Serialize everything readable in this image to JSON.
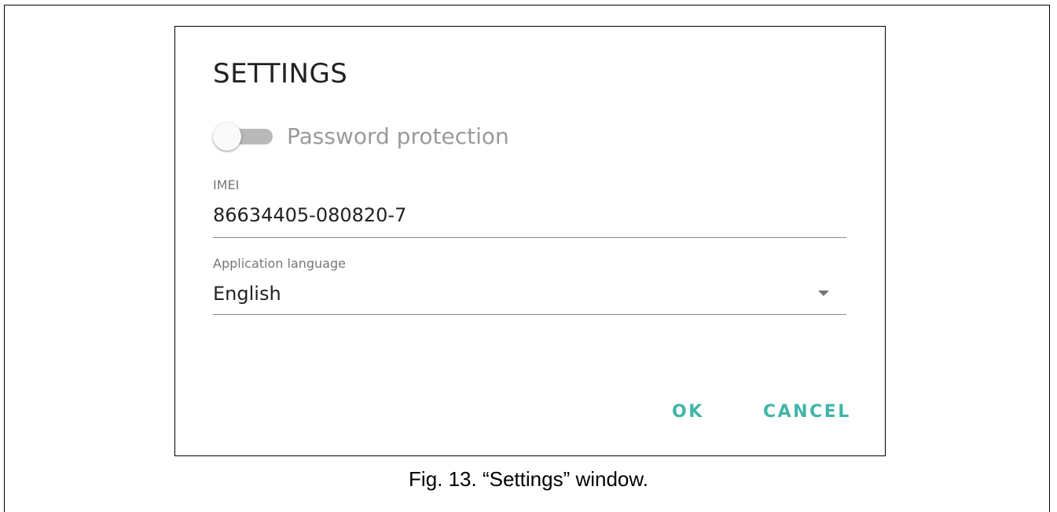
{
  "dialog": {
    "title": "SETTINGS",
    "password_protection": {
      "label": "Password protection",
      "enabled": false
    },
    "imei": {
      "label": "IMEI",
      "value": "86634405-080820-7"
    },
    "language": {
      "label": "Application language",
      "selected": "English"
    },
    "buttons": {
      "ok": "OK",
      "cancel": "CANCEL"
    }
  },
  "caption": "Fig. 13. “Settings” window.",
  "colors": {
    "accent": "#3fb5a8",
    "toggle_track_off": "#b9b9b9",
    "label_text": "#777777"
  }
}
